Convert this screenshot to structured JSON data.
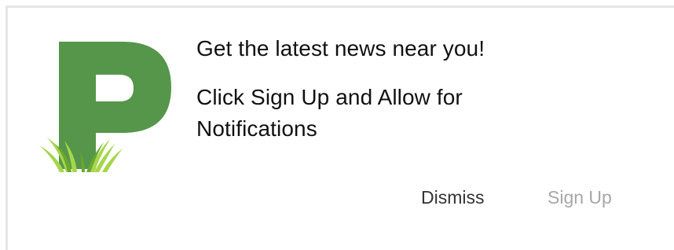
{
  "notification": {
    "headline": "Get the latest news near you!",
    "message": "Click Sign Up and Allow for Notifications",
    "dismiss_label": "Dismiss",
    "signup_label": "Sign Up",
    "logo_icon": "patch-p-grass-logo-icon"
  },
  "colors": {
    "logo_green": "#55964a",
    "grass_light": "#a6d64c",
    "grass_dark": "#6aa82f",
    "dismiss_text": "#333333",
    "signup_text": "#a7a7a7",
    "border": "#e6e6e6"
  }
}
